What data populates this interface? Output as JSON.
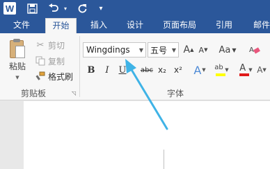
{
  "quick_access": {
    "app_icon": "word-icon",
    "app_icon_letter": "W",
    "save_icon": "save-icon",
    "undo_icon": "undo-icon",
    "redo_icon": "redo-icon",
    "undo_dropdown": "▾",
    "customize_dropdown": "▾"
  },
  "tabs": [
    {
      "label": "文件"
    },
    {
      "label": "开始"
    },
    {
      "label": "插入"
    },
    {
      "label": "设计"
    },
    {
      "label": "页面布局"
    },
    {
      "label": "引用"
    },
    {
      "label": "邮件"
    }
  ],
  "clipboard": {
    "paste_label": "粘贴",
    "cut_label": "剪切",
    "copy_label": "复制",
    "format_painter_label": "格式刷",
    "group_label": "剪贴板"
  },
  "font": {
    "name_value": "Wingdings",
    "size_value": "五号",
    "group_label": "字体",
    "change_case_label": "Aa",
    "bold": "B",
    "italic": "I",
    "underline": "U",
    "strikethrough": "abc",
    "subscript": "x₂",
    "superscript": "x²",
    "text_effects": "A",
    "highlight": "ab",
    "font_color": "A",
    "highlight_color": "#ffff00",
    "font_color_value": "#e01b1b"
  },
  "colors": {
    "ribbon_blue": "#2b579a",
    "arrow_annotation": "#3fb3e6"
  }
}
